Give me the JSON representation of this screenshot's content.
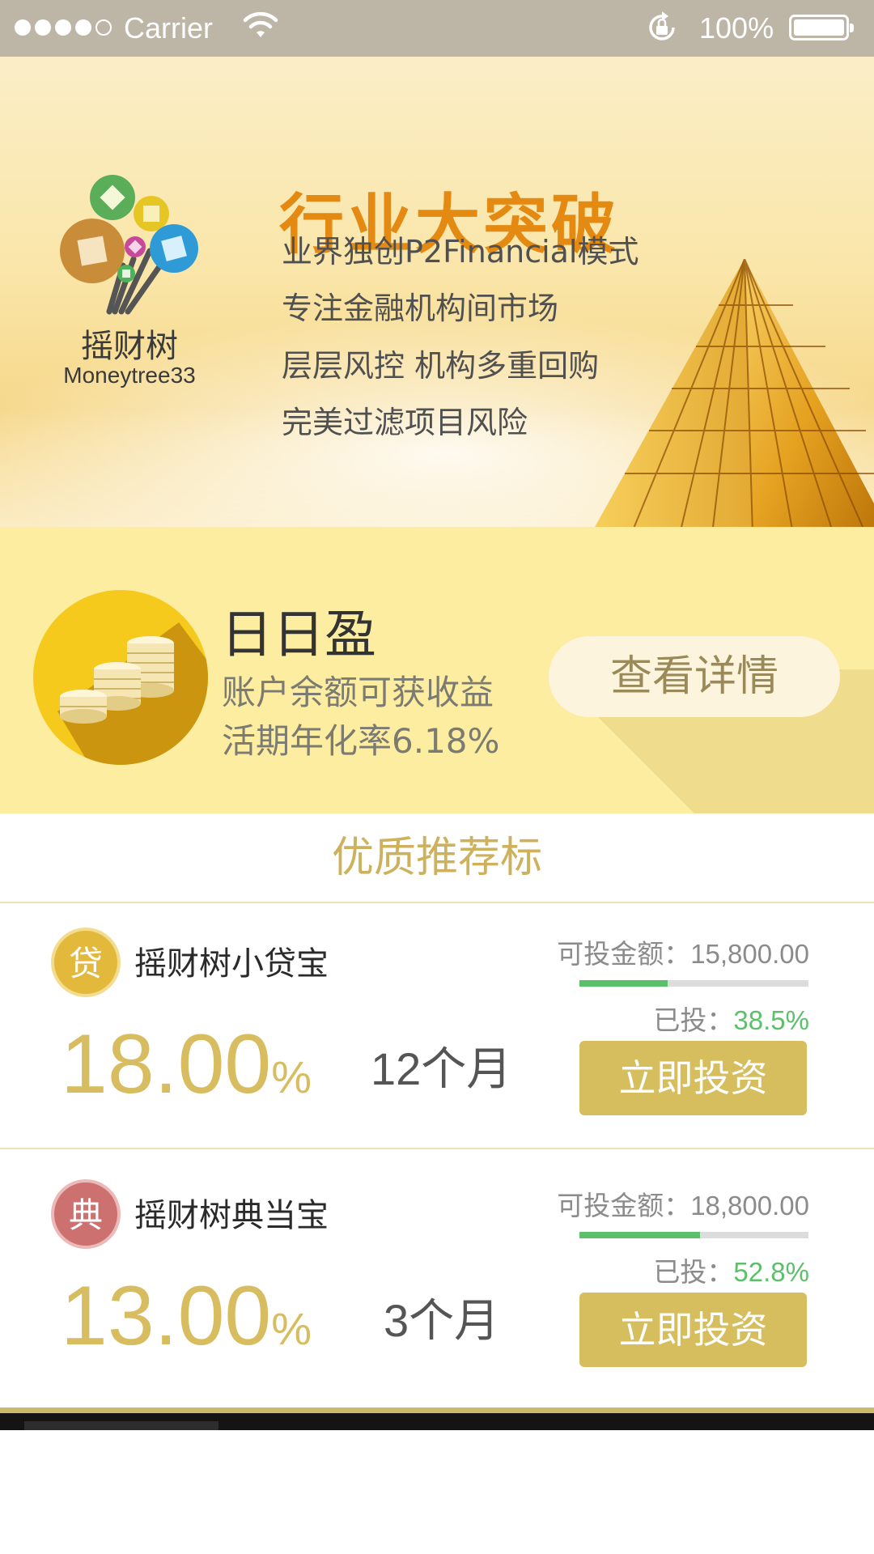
{
  "status_bar": {
    "carrier": "Carrier",
    "battery": "100%"
  },
  "banner": {
    "logo_name": "摇财树",
    "logo_en": "Moneytree33",
    "headline": "行业大突破",
    "lines": [
      "业界独创P2Financial模式",
      "专注金融机构间市场",
      "层层风控 机构多重回购",
      "完美过滤项目风险"
    ],
    "slide_count": 3,
    "active_slide": 2
  },
  "daily": {
    "title": "日日盈",
    "sub1": "账户余额可获收益",
    "sub2": "活期年化率6.18%",
    "details_button": "查看详情"
  },
  "section": {
    "title": "优质推荐标"
  },
  "products": [
    {
      "badge": "贷",
      "name": "摇财树小贷宝",
      "rate": "18.00",
      "rate_unit": "%",
      "term": "12个月",
      "available": "可投金额：15,800.00",
      "invested_label": "已投：",
      "invested_value": "38.5%",
      "progress_fraction": 0.385,
      "button": "立即投资"
    },
    {
      "badge": "典",
      "name": "摇财树典当宝",
      "rate": "13.00",
      "rate_unit": "%",
      "term": "3个月",
      "available": "可投金额：18,800.00",
      "invested_label": "已投：",
      "invested_value": "52.8%",
      "progress_fraction": 0.528,
      "button": "立即投资"
    }
  ],
  "colors": {
    "accent_gold": "#d6be5e",
    "headline_orange": "#e48a12",
    "progress_green": "#5cc06a",
    "badge_gold": "#e3b93b",
    "badge_red": "#cc7070"
  }
}
